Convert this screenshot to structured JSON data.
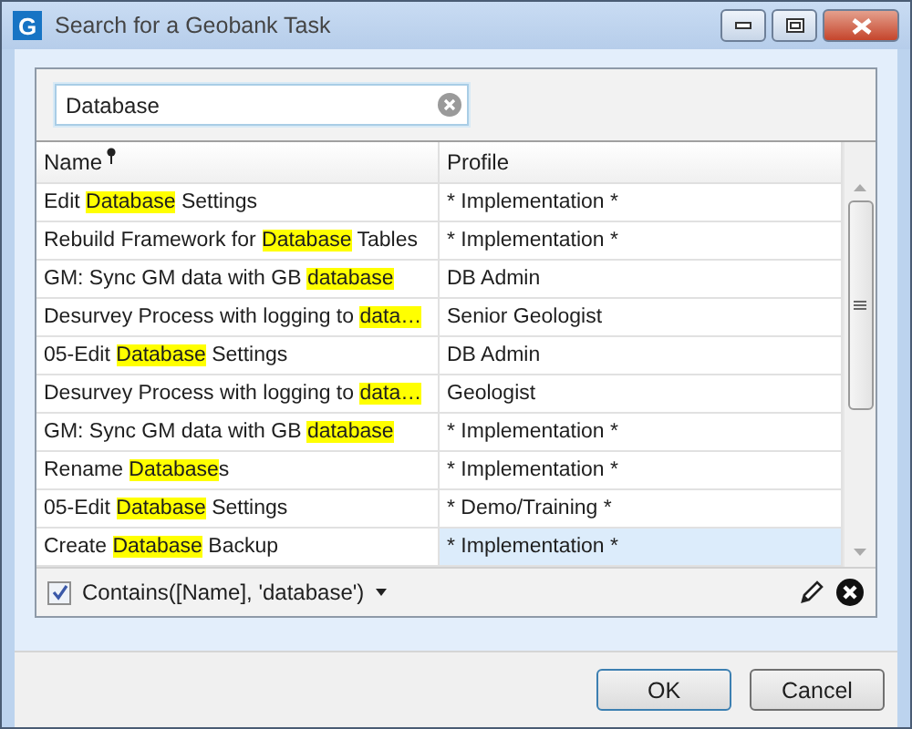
{
  "window": {
    "title": "Search for a Geobank Task",
    "app_letter": "G"
  },
  "search": {
    "value": "Database"
  },
  "table": {
    "columns": [
      "Name",
      "Profile"
    ],
    "rows": [
      {
        "name": [
          {
            "text": "Edit ",
            "highlighted": false
          },
          {
            "text": "Database",
            "highlighted": true
          },
          {
            "text": " Settings",
            "highlighted": false
          }
        ],
        "profile": "* Implementation *",
        "selected": false
      },
      {
        "name": [
          {
            "text": "Rebuild Framework for ",
            "highlighted": false
          },
          {
            "text": "Database",
            "highlighted": true
          },
          {
            "text": " Tables",
            "highlighted": false
          }
        ],
        "profile": "* Implementation *",
        "selected": false
      },
      {
        "name": [
          {
            "text": "GM: Sync GM data with GB ",
            "highlighted": false
          },
          {
            "text": "database",
            "highlighted": true
          }
        ],
        "profile": "DB Admin",
        "selected": false
      },
      {
        "name": [
          {
            "text": "Desurvey Process with logging to ",
            "highlighted": false
          },
          {
            "text": "data…",
            "highlighted": true
          }
        ],
        "profile": "Senior Geologist",
        "selected": false
      },
      {
        "name": [
          {
            "text": "05-Edit ",
            "highlighted": false
          },
          {
            "text": "Database",
            "highlighted": true
          },
          {
            "text": " Settings",
            "highlighted": false
          }
        ],
        "profile": "DB Admin",
        "selected": false
      },
      {
        "name": [
          {
            "text": "Desurvey Process with logging to ",
            "highlighted": false
          },
          {
            "text": "data…",
            "highlighted": true
          }
        ],
        "profile": "Geologist",
        "selected": false
      },
      {
        "name": [
          {
            "text": "GM: Sync GM data with GB ",
            "highlighted": false
          },
          {
            "text": "database",
            "highlighted": true
          }
        ],
        "profile": "* Implementation *",
        "selected": false
      },
      {
        "name": [
          {
            "text": "Rename ",
            "highlighted": false
          },
          {
            "text": "Database",
            "highlighted": true
          },
          {
            "text": "s",
            "highlighted": false
          }
        ],
        "profile": "* Implementation *",
        "selected": false
      },
      {
        "name": [
          {
            "text": "05-Edit ",
            "highlighted": false
          },
          {
            "text": "Database",
            "highlighted": true
          },
          {
            "text": " Settings",
            "highlighted": false
          }
        ],
        "profile": "* Demo/Training *",
        "selected": false
      },
      {
        "name": [
          {
            "text": "Create ",
            "highlighted": false
          },
          {
            "text": "Database",
            "highlighted": true
          },
          {
            "text": " Backup",
            "highlighted": false
          }
        ],
        "profile": "* Implementation *",
        "selected": true
      }
    ]
  },
  "filter": {
    "checked": true,
    "expression": "Contains([Name], 'database')"
  },
  "buttons": [
    "OK",
    "Cancel"
  ]
}
